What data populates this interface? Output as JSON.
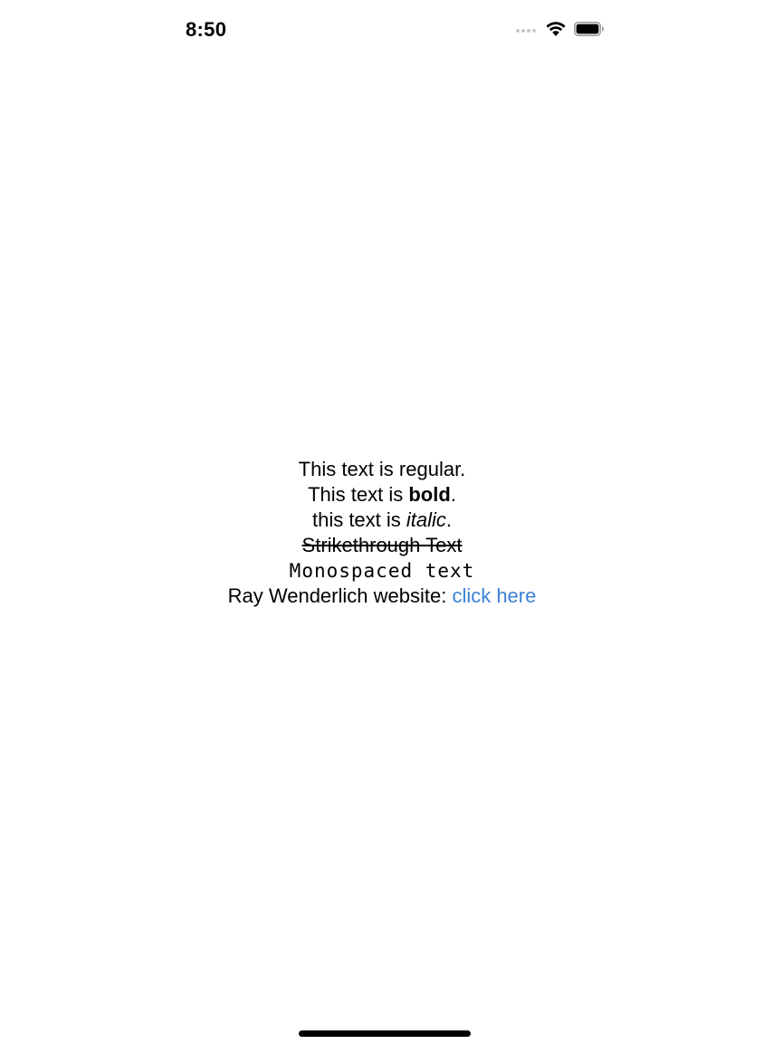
{
  "status_bar": {
    "time": "8:50",
    "icons": [
      "signal-icon",
      "wifi-icon",
      "battery-icon"
    ]
  },
  "content": {
    "regular": {
      "text": "This text is regular."
    },
    "bold_line": {
      "prefix": "This text is ",
      "emphasis": "bold",
      "suffix": "."
    },
    "italic_line": {
      "prefix": "this text is ",
      "emphasis": "italic",
      "suffix": "."
    },
    "strikethrough": {
      "text": "Strikethrough Text"
    },
    "monospaced": {
      "text": "Monospaced text"
    },
    "link_line": {
      "prefix": "Ray Wenderlich website: ",
      "link_text": "click here"
    }
  },
  "colors": {
    "link": "#3b82d6",
    "text": "#000000",
    "background": "#ffffff"
  }
}
